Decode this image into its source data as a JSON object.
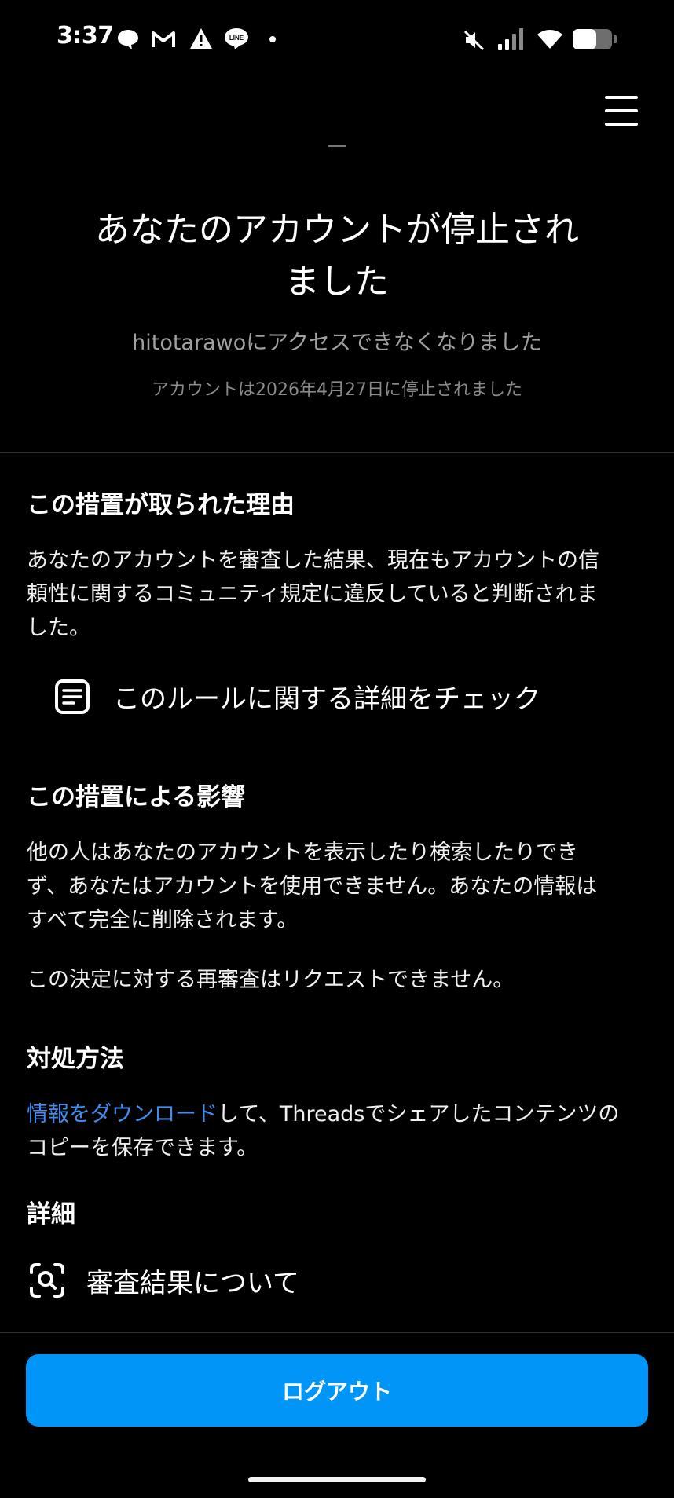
{
  "status_bar": {
    "time": "3:37",
    "left_icons": [
      "chat-bubble-icon",
      "gmail-icon",
      "warning-icon",
      "line-app-icon",
      "dot-icon"
    ],
    "line_icon_text": "LINE",
    "right_icons": [
      "mute-icon",
      "signal-icon",
      "wifi-icon",
      "battery-icon"
    ]
  },
  "header": {
    "headline_line1": "あなたのアカウントが停止され",
    "headline_line2": "ました",
    "subtitle": "hitotarawoにアクセスできなくなりました",
    "date_line": "アカウントは2026年4月27日に停止されました"
  },
  "reason": {
    "title": "この措置が取られた理由",
    "body_line1": "あなたのアカウントを審査した結果、現在もアカウントの信",
    "body_line2": "頼性に関するコミュニティ規定に違反していると判断されま",
    "body_line3": "した。",
    "rule_link": "このルールに関する詳細をチェック"
  },
  "impact": {
    "title": "この措置による影響",
    "body_line1": "他の人はあなたのアカウントを表示したり検索したりでき",
    "body_line2": "ず、あなたはアカウントを使用できません。あなたの情報は",
    "body_line3": "すべて完全に削除されます。",
    "no_review": "この決定に対する再審査はリクエストできません。"
  },
  "action": {
    "title": "対処方法",
    "download_link": "情報をダウンロード",
    "rest_line1": "して、Threadsでシェアしたコンテンツの",
    "line2": "コピーを保存できます。"
  },
  "details": {
    "title": "詳細",
    "review_link": "審査結果について"
  },
  "footer": {
    "logout_label": "ログアウト"
  },
  "colors": {
    "background": "#000000",
    "accent_button": "#0095f6",
    "link": "#3f8ef0",
    "muted_text": "#a0a0a0"
  }
}
